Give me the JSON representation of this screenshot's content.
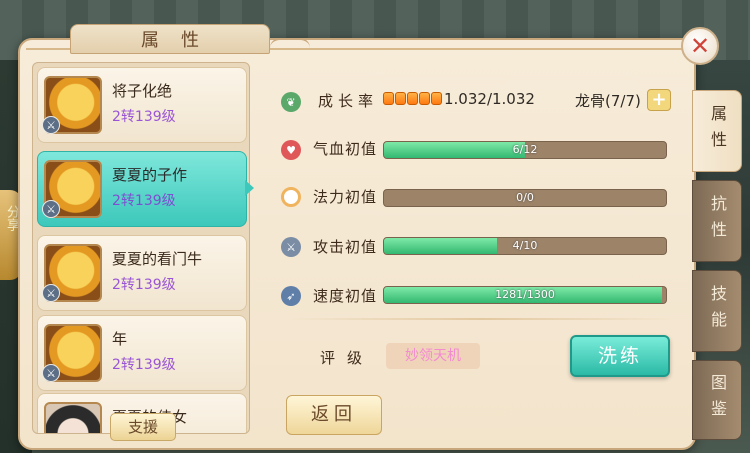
{
  "window": {
    "title": "属性"
  },
  "pets": [
    {
      "name": "将子化绝",
      "level": "2转139级",
      "avatar": "golden-dragon-avatar",
      "selected": false
    },
    {
      "name": "夏夏的子作",
      "level": "2转139级",
      "avatar": "golden-dragon-avatar",
      "selected": true
    },
    {
      "name": "夏夏的看门牛",
      "level": "2转139级",
      "avatar": "golden-dragon-avatar",
      "selected": false
    },
    {
      "name": "年",
      "level": "2转139级",
      "avatar": "golden-dragon-avatar",
      "selected": false
    },
    {
      "name": "夏夏的侍女",
      "level": "",
      "avatar": "maiden-avatar",
      "selected": false
    }
  ],
  "support_button": "支援",
  "growth": {
    "label": "成长率",
    "value": "1.032/1.032",
    "pips": 5
  },
  "dragon_bone": {
    "label": "龙骨(7/7)"
  },
  "stats": [
    {
      "key": "hp",
      "label": "气血初值",
      "text": "6/12",
      "current": 6,
      "max": 12,
      "icon": "heart-icon",
      "icon_color": "#e0575a"
    },
    {
      "key": "mp",
      "label": "法力初值",
      "text": "0/0",
      "current": 0,
      "max": 0,
      "icon": "mana-ring-icon",
      "icon_color": "#f0b35e"
    },
    {
      "key": "atk",
      "label": "攻击初值",
      "text": "4/10",
      "current": 4,
      "max": 10,
      "icon": "sword-icon",
      "icon_color": "#7a8da5"
    },
    {
      "key": "spd",
      "label": "速度初值",
      "text": "1281/1300",
      "current": 1281,
      "max": 1300,
      "icon": "speed-icon",
      "icon_color": "#5f7fa8"
    }
  ],
  "rating": {
    "label": "评级",
    "value": "妙领天机"
  },
  "refine_button": "洗练",
  "back_button": "返回",
  "side_tabs": [
    {
      "label": "属性",
      "active": true
    },
    {
      "label": "抗性",
      "active": false
    },
    {
      "label": "技能",
      "active": false
    },
    {
      "label": "图鉴",
      "active": false
    }
  ],
  "background_text": "分享",
  "colors": {
    "accent_teal": "#3cc8bb",
    "bar_fill": "#33b871",
    "level_purple": "#9a55d6"
  }
}
